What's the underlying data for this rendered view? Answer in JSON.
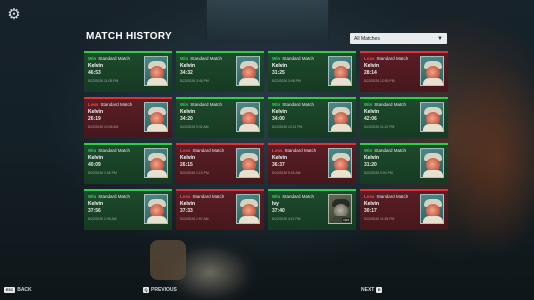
{
  "header": {
    "title": "MATCH HISTORY",
    "settings_icon": "gear-icon"
  },
  "filter": {
    "selected": "All Matches",
    "icon": "chevron-down-icon"
  },
  "matches": [
    {
      "result": "Win",
      "mode": "Standard Match",
      "player": "Kelvin",
      "time": "46:53",
      "date": "5/22/2026 11:05 PM"
    },
    {
      "result": "Win",
      "mode": "Standard Match",
      "player": "Kelvin",
      "time": "34:32",
      "date": "5/22/2026 3:46 PM"
    },
    {
      "result": "Win",
      "mode": "Standard Match",
      "player": "Kelvin",
      "time": "31:25",
      "date": "5/22/2026 3:08 PM"
    },
    {
      "result": "Loss",
      "mode": "Standard Match",
      "player": "Kelvin",
      "time": "28:14",
      "date": "5/22/2026 12:50 PM"
    },
    {
      "result": "Loss",
      "mode": "Standard Match",
      "player": "Kelvin",
      "time": "26:19",
      "date": "5/22/2026 10:08 AM"
    },
    {
      "result": "Win",
      "mode": "Standard Match",
      "player": "Kelvin",
      "time": "34:20",
      "date": "5/22/2026 9:32 AM"
    },
    {
      "result": "Win",
      "mode": "Standard Match",
      "player": "Kelvin",
      "time": "34:00",
      "date": "5/22/2026 12:11 PM"
    },
    {
      "result": "Win",
      "mode": "Standard Match",
      "player": "Kelvin",
      "time": "42:06",
      "date": "5/22/2026 11:12 PM"
    },
    {
      "result": "Win",
      "mode": "Standard Match",
      "player": "Kelvin",
      "time": "40:09",
      "date": "5/22/2026 1:06 PM"
    },
    {
      "result": "Loss",
      "mode": "Standard Match",
      "player": "Kelvin",
      "time": "26:15",
      "date": "5/22/2026 1:19 PM"
    },
    {
      "result": "Loss",
      "mode": "Standard Match",
      "player": "Kelvin",
      "time": "36:37",
      "date": "5/22/2026 9:02 AM"
    },
    {
      "result": "Win",
      "mode": "Standard Match",
      "player": "Kelvin",
      "time": "31:20",
      "date": "5/22/2026 9:00 PM"
    },
    {
      "result": "Win",
      "mode": "Standard Match",
      "player": "Kelvin",
      "time": "37:56",
      "date": "5/22/2026 2:39 AM"
    },
    {
      "result": "Loss",
      "mode": "Standard Match",
      "player": "Kelvin",
      "time": "37:33",
      "date": "5/22/2026 1:57 AM"
    },
    {
      "result": "Win",
      "mode": "Standard Match",
      "player": "Ivy",
      "time": "37:40",
      "date": "5/22/2026 4:11 PM",
      "portrait_tag": "19/4"
    },
    {
      "result": "Loss",
      "mode": "Standard Match",
      "player": "Kelvin",
      "time": "30:17",
      "date": "5/22/2026 11:35 PM"
    }
  ],
  "footer": {
    "back_key": "ESC",
    "back_label": "BACK",
    "previous_key": "Q",
    "previous_label": "PREVIOUS",
    "next_label": "NEXT",
    "next_key": "E"
  },
  "colors": {
    "win": "#34d45a",
    "loss": "#ff4a4a",
    "win_card": "#1d4a2c",
    "loss_card": "#5a1e25"
  }
}
